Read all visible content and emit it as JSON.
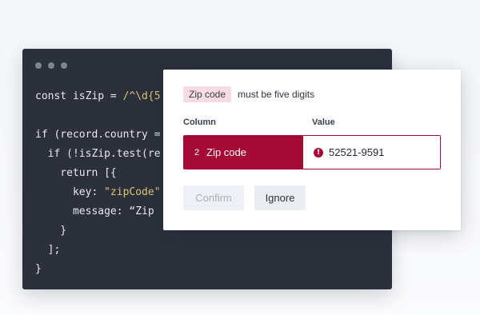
{
  "editor": {
    "code_lines": [
      [
        {
          "t": "const isZip = "
        },
        {
          "t": "/^\\d{5",
          "c": "rx"
        }
      ],
      [],
      [
        {
          "t": "if (record.country ="
        }
      ],
      [
        {
          "t": "  if (!isZip.test(re"
        }
      ],
      [
        {
          "t": "    return [{"
        }
      ],
      [
        {
          "t": "      key: "
        },
        {
          "t": "\"zipCode\"",
          "c": "str"
        }
      ],
      [
        {
          "t": "      message: “Zip"
        }
      ],
      [
        {
          "t": "    }"
        }
      ],
      [
        {
          "t": "  ];"
        }
      ],
      [
        {
          "t": "}"
        }
      ]
    ]
  },
  "card": {
    "tag_label": "Zip code",
    "message": "must be five digits",
    "col_header_column": "Column",
    "col_header_value": "Value",
    "row": {
      "index": "2",
      "column_name": "Zip code",
      "value": "52521-9591",
      "error_icon_glyph": "!"
    },
    "confirm_label": "Confirm",
    "ignore_label": "Ignore"
  },
  "colors": {
    "accent": "#a50a36",
    "editor_bg": "#2b303b",
    "tag_bg": "#f7dde3"
  }
}
